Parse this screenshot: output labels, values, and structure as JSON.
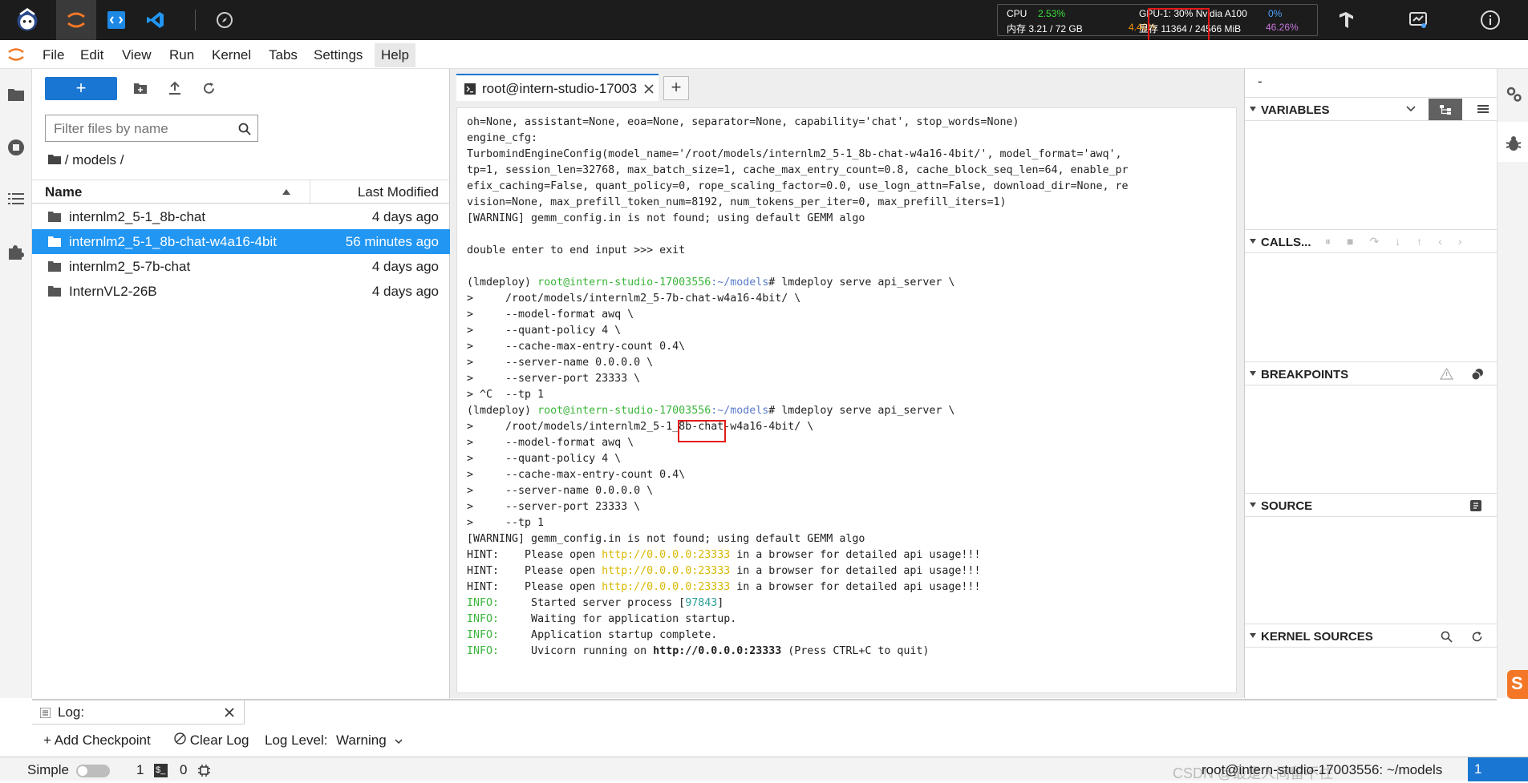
{
  "topbar": {
    "cpu_label": "CPU",
    "cpu_value": "2.53%",
    "mem_label": "内存 3.21 / 72 GB",
    "mem_value": "4.46%",
    "gpu_label": "GPU-1: 30% Nvidia A100",
    "gpu_value": "0%",
    "vram_label": "显存 11364 / 24566 MiB",
    "vram_value": "46.26%",
    "colors": {
      "green": "#3ddc3d",
      "orange": "#ff9800",
      "blue": "#4ea1ff",
      "purple": "#c678dd",
      "highlight": "#e21a1a"
    }
  },
  "menu": [
    "File",
    "Edit",
    "View",
    "Run",
    "Kernel",
    "Tabs",
    "Settings",
    "Help"
  ],
  "filebrowser": {
    "new_label": "+",
    "filter_placeholder": "Filter files by name",
    "breadcrumb": "/ models /",
    "col_name": "Name",
    "col_modified": "Last Modified",
    "rows": [
      {
        "name": "internlm2_5-1_8b-chat",
        "modified": "4 days ago"
      },
      {
        "name": "internlm2_5-1_8b-chat-w4a16-4bit",
        "modified": "56 minutes ago"
      },
      {
        "name": "internlm2_5-7b-chat",
        "modified": "4 days ago"
      },
      {
        "name": "InternVL2-26B",
        "modified": "4 days ago"
      }
    ]
  },
  "terminal": {
    "tab_title": "root@intern-studio-17003",
    "plus": "+",
    "lines": {
      "l1": "oh=None, assistant=None, eoa=None, separator=None, capability='chat', stop_words=None)",
      "l2": "engine_cfg:",
      "l3": "TurbomindEngineConfig(model_name='/root/models/internlm2_5-1_8b-chat-w4a16-4bit/', model_format='awq',",
      "l4": "tp=1, session_len=32768, max_batch_size=1, cache_max_entry_count=0.8, cache_block_seq_len=64, enable_pr",
      "l5": "efix_caching=False, quant_policy=0, rope_scaling_factor=0.0, use_logn_attn=False, download_dir=None, re",
      "l6": "vision=None, max_prefill_token_num=8192, num_tokens_per_iter=0, max_prefill_iters=1)",
      "l7": "[WARNING] gemm_config.in is not found; using default GEMM algo",
      "l8": "double enter to end input >>> exit",
      "env": "(lmdeploy) ",
      "user": "root@intern-studio-17003556",
      "path": ":~/models",
      "cmd": "# lmdeploy serve api_server \\",
      "p1": ">     /root/models/internlm2_5-7b-chat-w4a16-4bit/ \\",
      "p2": ">     --model-format awq \\",
      "p3": ">     --quant-policy 4 \\",
      "p4": ">     --cache-max-entry-count 0.4\\",
      "p5": ">     --server-name 0.0.0.0 \\",
      "p6": ">     --server-port 23333 \\",
      "p7": "> ^C  --tp 1",
      "q1": ">     /root/models/internlm2_5-1_8b-chat-w4a16-4bit/ \\",
      "q7": ">     --tp 1",
      "hint_pre": "HINT:    Please open ",
      "url": "http://0.0.0.0:23333",
      "hint_post": " in a browser for detailed api usage!!!",
      "info": "INFO:",
      "i1": "     Started server process [",
      "pid": "97843",
      "i1b": "]",
      "i2": "     Waiting for application startup.",
      "i3": "     Application startup complete.",
      "i4a": "     Uvicorn running on ",
      "i4b": "http://0.0.0.0:23333",
      "i4c": " (Press CTRL+C to quit)"
    }
  },
  "debugger": {
    "top_label": "-",
    "variables": "VARIABLES",
    "callstack": "CALLS...",
    "breakpoints": "BREAKPOINTS",
    "source": "SOURCE",
    "kernel_sources": "KERNEL SOURCES"
  },
  "log": {
    "title": "Log:",
    "add_checkpoint": "Add Checkpoint",
    "clear_log": "Clear Log",
    "level_label": "Log Level:",
    "level_value": "Warning"
  },
  "status": {
    "mode": "Simple",
    "count1": "1",
    "count2": "0",
    "right_text": "root@intern-studio-17003556: ~/models",
    "corner": "1",
    "watermark": "CSDN @最是人间留不住"
  }
}
